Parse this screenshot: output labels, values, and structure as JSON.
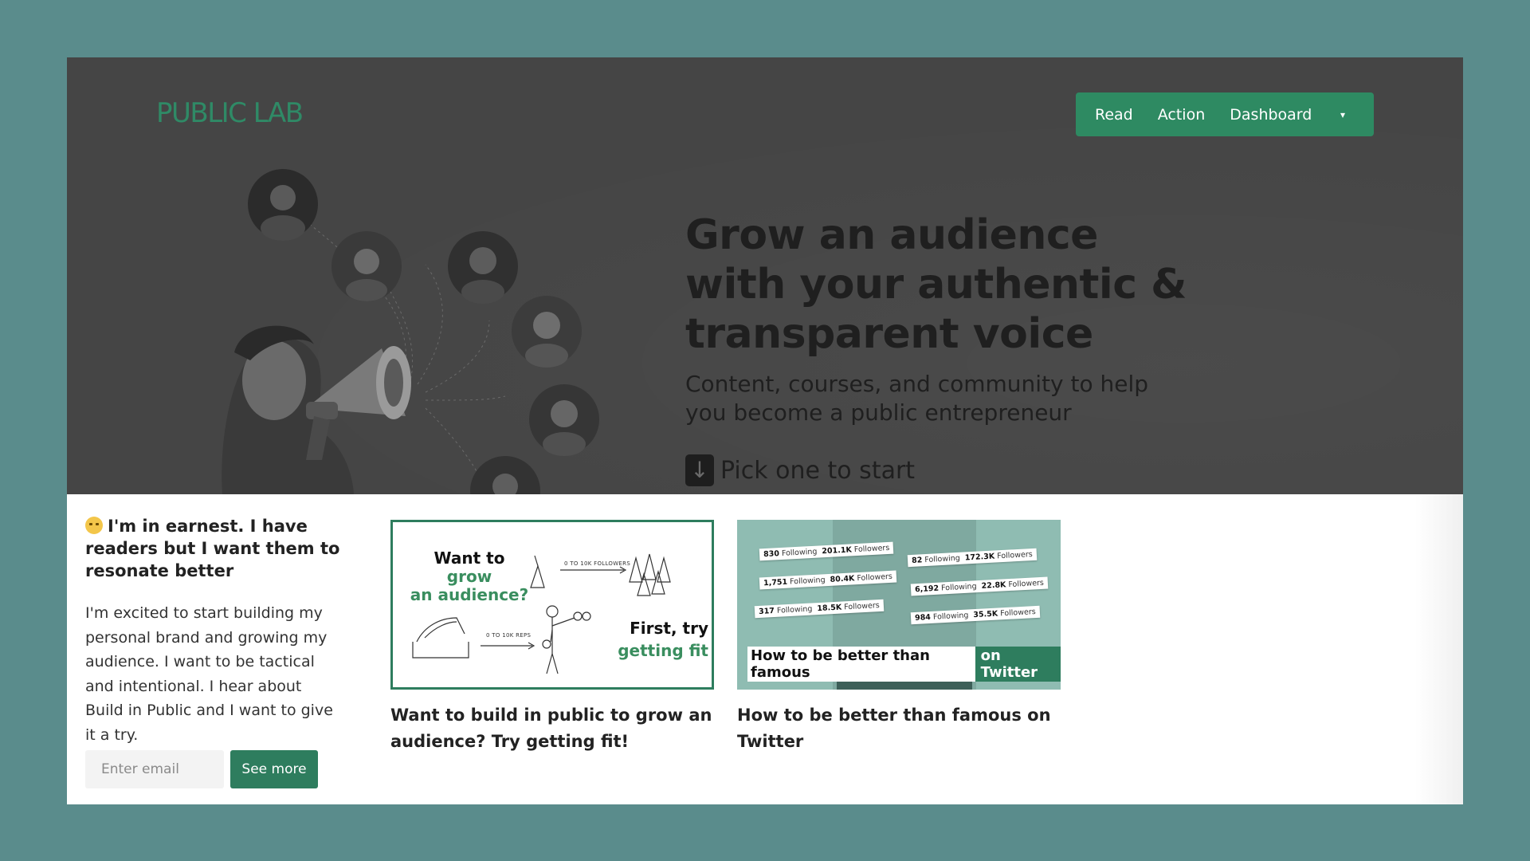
{
  "header": {
    "logo": "PUBLIC LAB",
    "nav": [
      {
        "label": "Read"
      },
      {
        "label": "Action"
      },
      {
        "label": "Dashboard"
      }
    ],
    "dropdown_glyph": "▾"
  },
  "hero": {
    "title": "Grow an audience with your authentic & transparent voice",
    "subtitle": "Content, courses, and community to help you become a public entrepreneur",
    "cta_icon": "arrow-down-icon",
    "cta_glyph": "↓",
    "cta_text": "Pick one to start"
  },
  "persona": {
    "emoji": "grimacing-face-icon",
    "title": "I'm in earnest. I have readers but I want them to resonate better",
    "body": "I'm excited to start building my personal brand and growing my audience. I want to be tactical and intentional. I hear about Build in Public and I want to give it a try.",
    "email_placeholder": "Enter email",
    "button_label": "See more"
  },
  "cards": [
    {
      "title": "Want to build in public to grow an audience? Try getting fit!",
      "image": {
        "line1_a": "Want to ",
        "line1_b": "grow",
        "line2": "an audience?",
        "label_top": "0 TO 10K FOLLOWERS",
        "label_bottom": "0 TO 10K REPS",
        "line3": "First, try",
        "line4": "getting fit"
      }
    },
    {
      "title": "How to be better than famous on Twitter",
      "image": {
        "chips": [
          {
            "following": "830",
            "followers": "201.1K"
          },
          {
            "following": "1,751",
            "followers": "80.4K"
          },
          {
            "following": "317",
            "followers": "18.5K"
          },
          {
            "following": "82",
            "followers": "172.3K"
          },
          {
            "following": "6,192",
            "followers": "22.8K"
          },
          {
            "following": "984",
            "followers": "35.5K"
          }
        ],
        "following_word": "Following",
        "followers_word": "Followers",
        "caption_a": "How to be better than famous",
        "caption_b": "on Twitter"
      }
    }
  ],
  "colors": {
    "accent": "#2e7d5e",
    "hero_bg": "#454545",
    "page_bg": "#5a8c8c"
  }
}
